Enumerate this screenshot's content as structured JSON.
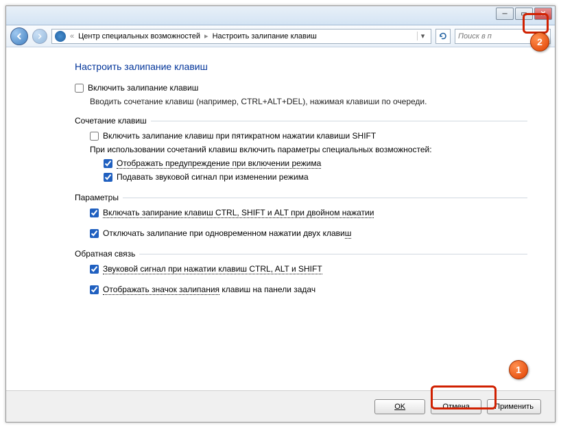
{
  "breadcrumb": {
    "item1": "Центр специальных возможностей",
    "item2": "Настроить залипание клавиш"
  },
  "search": {
    "placeholder": "Поиск в п"
  },
  "title": "Настроить залипание клавиш",
  "main_checkbox": {
    "label": "Включить залипание клавиш",
    "checked": false
  },
  "main_desc": "Вводить сочетание клавиш (например, CTRL+ALT+DEL), нажимая клавиши по очереди.",
  "group1": {
    "label": "Сочетание клавиш",
    "cb1": {
      "label": "Включить залипание клавиш при пятикратном нажатии клавиши SHIFT",
      "checked": false
    },
    "desc": "При использовании сочетаний клавиш включить параметры специальных возможностей:",
    "cb2": {
      "label": "Отображать предупреждение при включении режима",
      "checked": true
    },
    "cb3": {
      "label": "Подавать звуковой сигнал при изменении режима",
      "checked": true
    }
  },
  "group2": {
    "label": "Параметры",
    "cb1": {
      "label": "Включать запирание клавиш CTRL, SHIFT и ALT при двойном нажатии",
      "checked": true
    },
    "cb2": {
      "label": "Отключать залипание при одновременном нажатии двух клави",
      "suffix": "ш",
      "checked": true
    }
  },
  "group3": {
    "label": "Обратная связь",
    "cb1": {
      "label": "Звуковой сигнал при нажатии клавиш CTRL, ALT и SHIFT",
      "checked": true
    },
    "cb2": {
      "label": "Отображать значок залипания",
      "mid": " клавиш на панели задач",
      "checked": true
    }
  },
  "buttons": {
    "ok": "OK",
    "cancel": "Отмена",
    "apply": "Применить"
  },
  "callouts": {
    "one": "1",
    "two": "2"
  }
}
